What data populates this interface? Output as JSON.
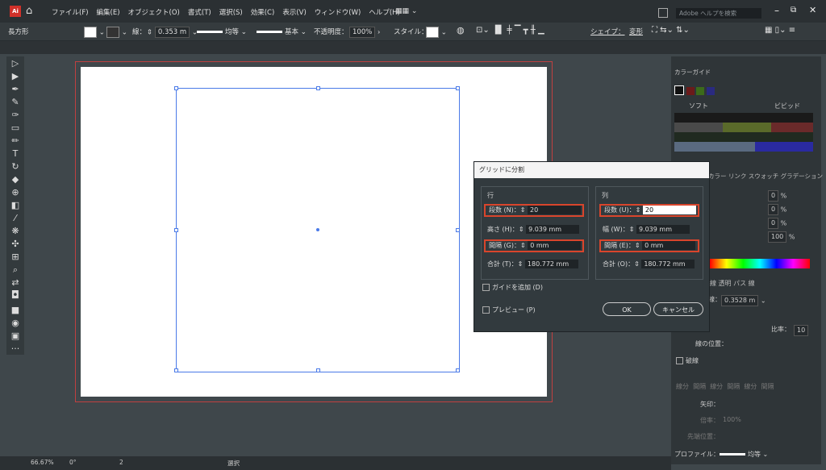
{
  "app": {
    "logo_label": "Ai"
  },
  "menu": [
    "ファイル(F)",
    "編集(E)",
    "オブジェクト(O)",
    "書式(T)",
    "選択(S)",
    "効果(C)",
    "表示(V)",
    "ウィンドウ(W)",
    "ヘルプ(H)"
  ],
  "search": {
    "placeholder": "Adobe ヘルプを検索"
  },
  "control_bar": {
    "object_type": "長方形",
    "stroke_label": "線：",
    "stroke_value": "0.353 m",
    "profile_label": "均等",
    "brush_label": "基本",
    "opacity_label": "不透明度：",
    "opacity_value": "100%",
    "style_label": "スタイル：",
    "shape_label": "シェイプ：",
    "transform_label": "変形"
  },
  "panel": {
    "title": "カラーガイド",
    "soft_label": "ソフト",
    "vivid_label": "ビビッド",
    "tabs2": "カラー  リンク  スウォッチ  グラデーション",
    "pct_values": [
      "0",
      "0",
      "0",
      "100"
    ],
    "pct_unit": "%",
    "tabs3": "線  透明  パス  線",
    "weight_label": "線：",
    "weight_value": "0.3528 m",
    "ratio_label": "比率：",
    "ratio_value": "10",
    "align_label": "線の位置：",
    "dash_label": "破線",
    "dash_cells": [
      "線分",
      "間隔",
      "線分",
      "間隔",
      "線分",
      "間隔"
    ],
    "arrow_label": "矢印：",
    "scale_label": "倍率：",
    "scale_value": "100%",
    "arrow_pos_label": "先端位置：",
    "profile_label": "プロファイル：",
    "profile_value": "均等"
  },
  "status": {
    "zoom": "66.67%",
    "rotation": "0°",
    "artboard_num": "2",
    "tool_label": "選択"
  },
  "dialog": {
    "title": "グリッドに分割",
    "rows_label": "行",
    "cols_label": "列",
    "rows": {
      "count_label": "段数 (N)：",
      "count_value": "20",
      "height_label": "高さ (H)：",
      "height_value": "9.039 mm",
      "gutter_label": "間隔 (G)：",
      "gutter_value": "0 mm",
      "total_label": "合計 (T)：",
      "total_value": "180.772 mm"
    },
    "cols": {
      "count_label": "段数 (U)：",
      "count_value": "20",
      "width_label": "幅 (W)：",
      "width_value": "9.039 mm",
      "gutter_label": "間隔 (E)：",
      "gutter_value": "0 mm",
      "total_label": "合計 (O)：",
      "total_value": "180.772 mm"
    },
    "add_guides_label": "ガイドを追加 (D)",
    "preview_label": "プレビュー (P)",
    "ok_label": "OK",
    "cancel_label": "キャンセル"
  }
}
